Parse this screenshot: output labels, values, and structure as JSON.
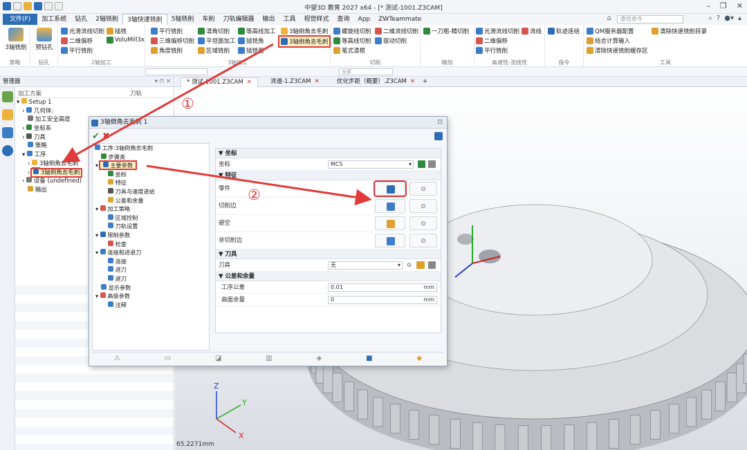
{
  "window": {
    "title": "中望3D 教育 2027 x64 - [* 测试-1001.Z3CAM]"
  },
  "menu": {
    "file": "文件(F)",
    "items": [
      "加工系统",
      "钻孔",
      "2轴铣削",
      "3轴快速铣削",
      "5轴铣削",
      "车削",
      "刀轨编辑器",
      "输出",
      "工具",
      "视觉样式",
      "查询",
      "App",
      "ZWTeammate"
    ]
  },
  "search": {
    "placeholder": "查找命令"
  },
  "ribbon": {
    "g1": {
      "label": "策略",
      "btn": "3轴铣削"
    },
    "g2": {
      "label": "钻孔",
      "btn": "预钻孔"
    },
    "g3": {
      "label": "2轴加工",
      "items": [
        "光滑流线切削",
        "二维偏移",
        "平行铣削",
        "插铣",
        "VoluMill3x"
      ]
    },
    "g4": {
      "label": "3轴加工",
      "items": [
        "平行铣削",
        "三维偏移切削",
        "角度铣削",
        "清角切削",
        "平坦面加工",
        "区域铣削",
        "等高线加工",
        "插铣角",
        "插铣面",
        "3轴倒角去毛刺",
        "3轴倒角去毛刺"
      ]
    },
    "g5": {
      "label": "切削",
      "items": [
        "螺旋线切削",
        "等高线切削",
        "笔式清根",
        "二维流线切削",
        "驱动切削"
      ]
    },
    "g6": {
      "label": "精加",
      "items": [
        "一刀粗-精切削"
      ]
    },
    "g7": {
      "label": "高速铣-流线铣",
      "items": [
        "光滑流线切削",
        "流线",
        "二维偏移",
        "平行铣削"
      ]
    },
    "g8": {
      "label": "指令",
      "items": [
        "轨迹连结"
      ]
    },
    "g9": {
      "label": "工具",
      "items": [
        "QM服务器配置",
        "结合计算输入",
        "清除快速铣削缓存区",
        "清除快速铣削目录"
      ]
    }
  },
  "toolrow": {
    "filter": "全部"
  },
  "manager": {
    "title": "管理器",
    "col1": "加工方案",
    "col2": "刀轨",
    "tree": [
      "Setup 1",
      "几何体:",
      "加工安全高度",
      "坐标系",
      "刀具",
      "策略",
      "工序",
      "3轴倒角去毛刺",
      "3轴倒角去毛刺",
      "设备 (undefined)",
      "输出"
    ]
  },
  "tabs": [
    {
      "label": "* 测试-1001.Z3CAM"
    },
    {
      "label": "流道-1.Z3CAM"
    },
    {
      "label": "优化步距（概要）.Z3CAM"
    }
  ],
  "dialog": {
    "title": "3轴倒角去毛刺 1",
    "tree": [
      "工序:3轴倒角去毛刺",
      "步骤类",
      "主要参数",
      "坐标",
      "特征",
      "刀具与速度进给",
      "公差和余量",
      "加工策略",
      "区域控制",
      "刀轨设置",
      "限制参数",
      "检查",
      "连接和进退刀",
      "连接",
      "进刀",
      "退刀",
      "显示参数",
      "高级参数",
      "注释"
    ],
    "sections": {
      "coord": "坐标",
      "feature": "特征",
      "tool": "刀具",
      "tolerance": "公差和余量"
    },
    "rows": {
      "coord_label": "坐标",
      "coord_value": "MCS",
      "part": "零件",
      "cut_edge": "切削边",
      "avoid": "避空",
      "non_cut_edge": "非切削边",
      "tool_label": "刀具",
      "tool_value": "无",
      "tol_label": "工序公差",
      "tol_value": "0.01",
      "tol_unit": "mm",
      "stock_label": "曲面余量",
      "stock_value": "0",
      "stock_unit": "mm"
    }
  },
  "annotations": {
    "a1": "①",
    "a2": "②"
  },
  "status": {
    "length": "65.2271mm"
  },
  "triad": {
    "x": "X",
    "y": "Y",
    "z": "Z"
  }
}
